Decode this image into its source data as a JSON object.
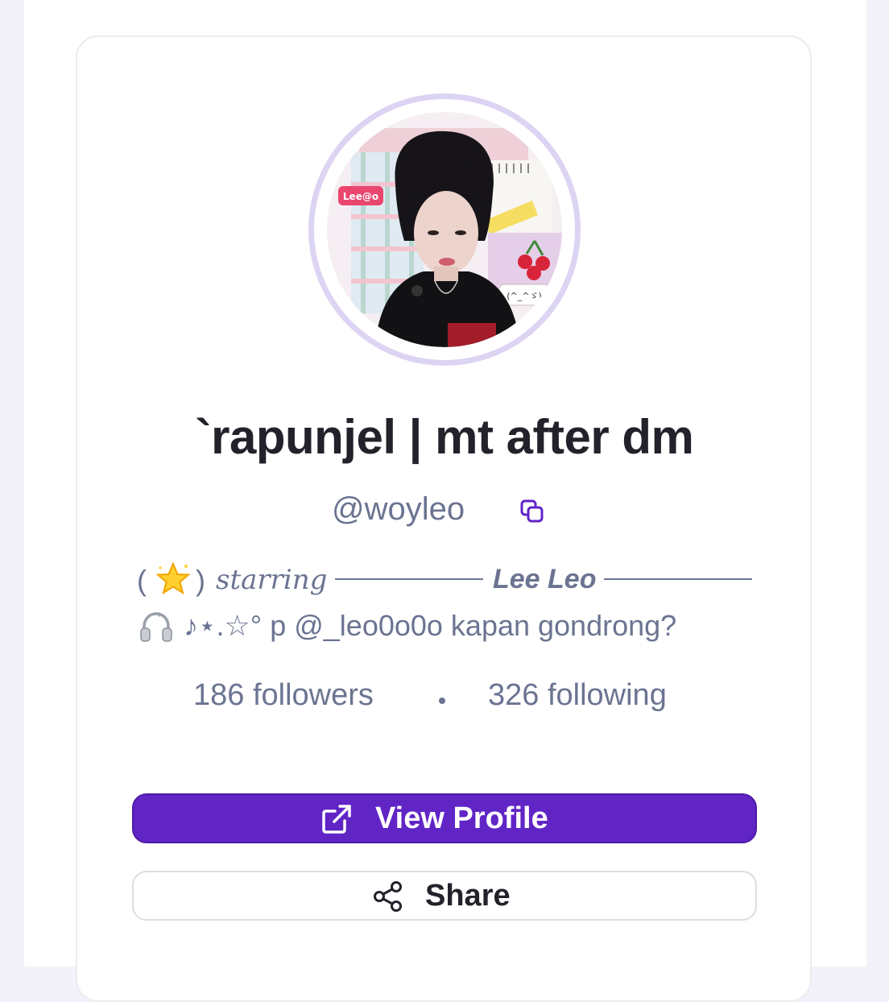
{
  "profile": {
    "display_name": "`rapunjel | mt after dm",
    "handle": "@woyleo",
    "avatar_sticker_text": "Lee@o",
    "avatar_kaomoji": "(^_^ゞ)"
  },
  "bio": {
    "line1_open_paren": "(",
    "line1_close_paren": ")",
    "line1_emoji": "star-emoji",
    "line1_starring": "starring",
    "line1_name": "Lee Leo",
    "line2_emoji": "headphones-emoji",
    "line2_text": "♪⋆.☆° p @_leo0o0o kapan gondrong?"
  },
  "stats": {
    "followers": "186 followers",
    "following": "326 following"
  },
  "actions": {
    "view_profile_label": "View Profile",
    "share_label": "Share"
  },
  "colors": {
    "accent": "#6125c6",
    "text_muted": "#6b7491",
    "text_dark": "#23222b",
    "avatar_ring": "#ddd3f2"
  }
}
